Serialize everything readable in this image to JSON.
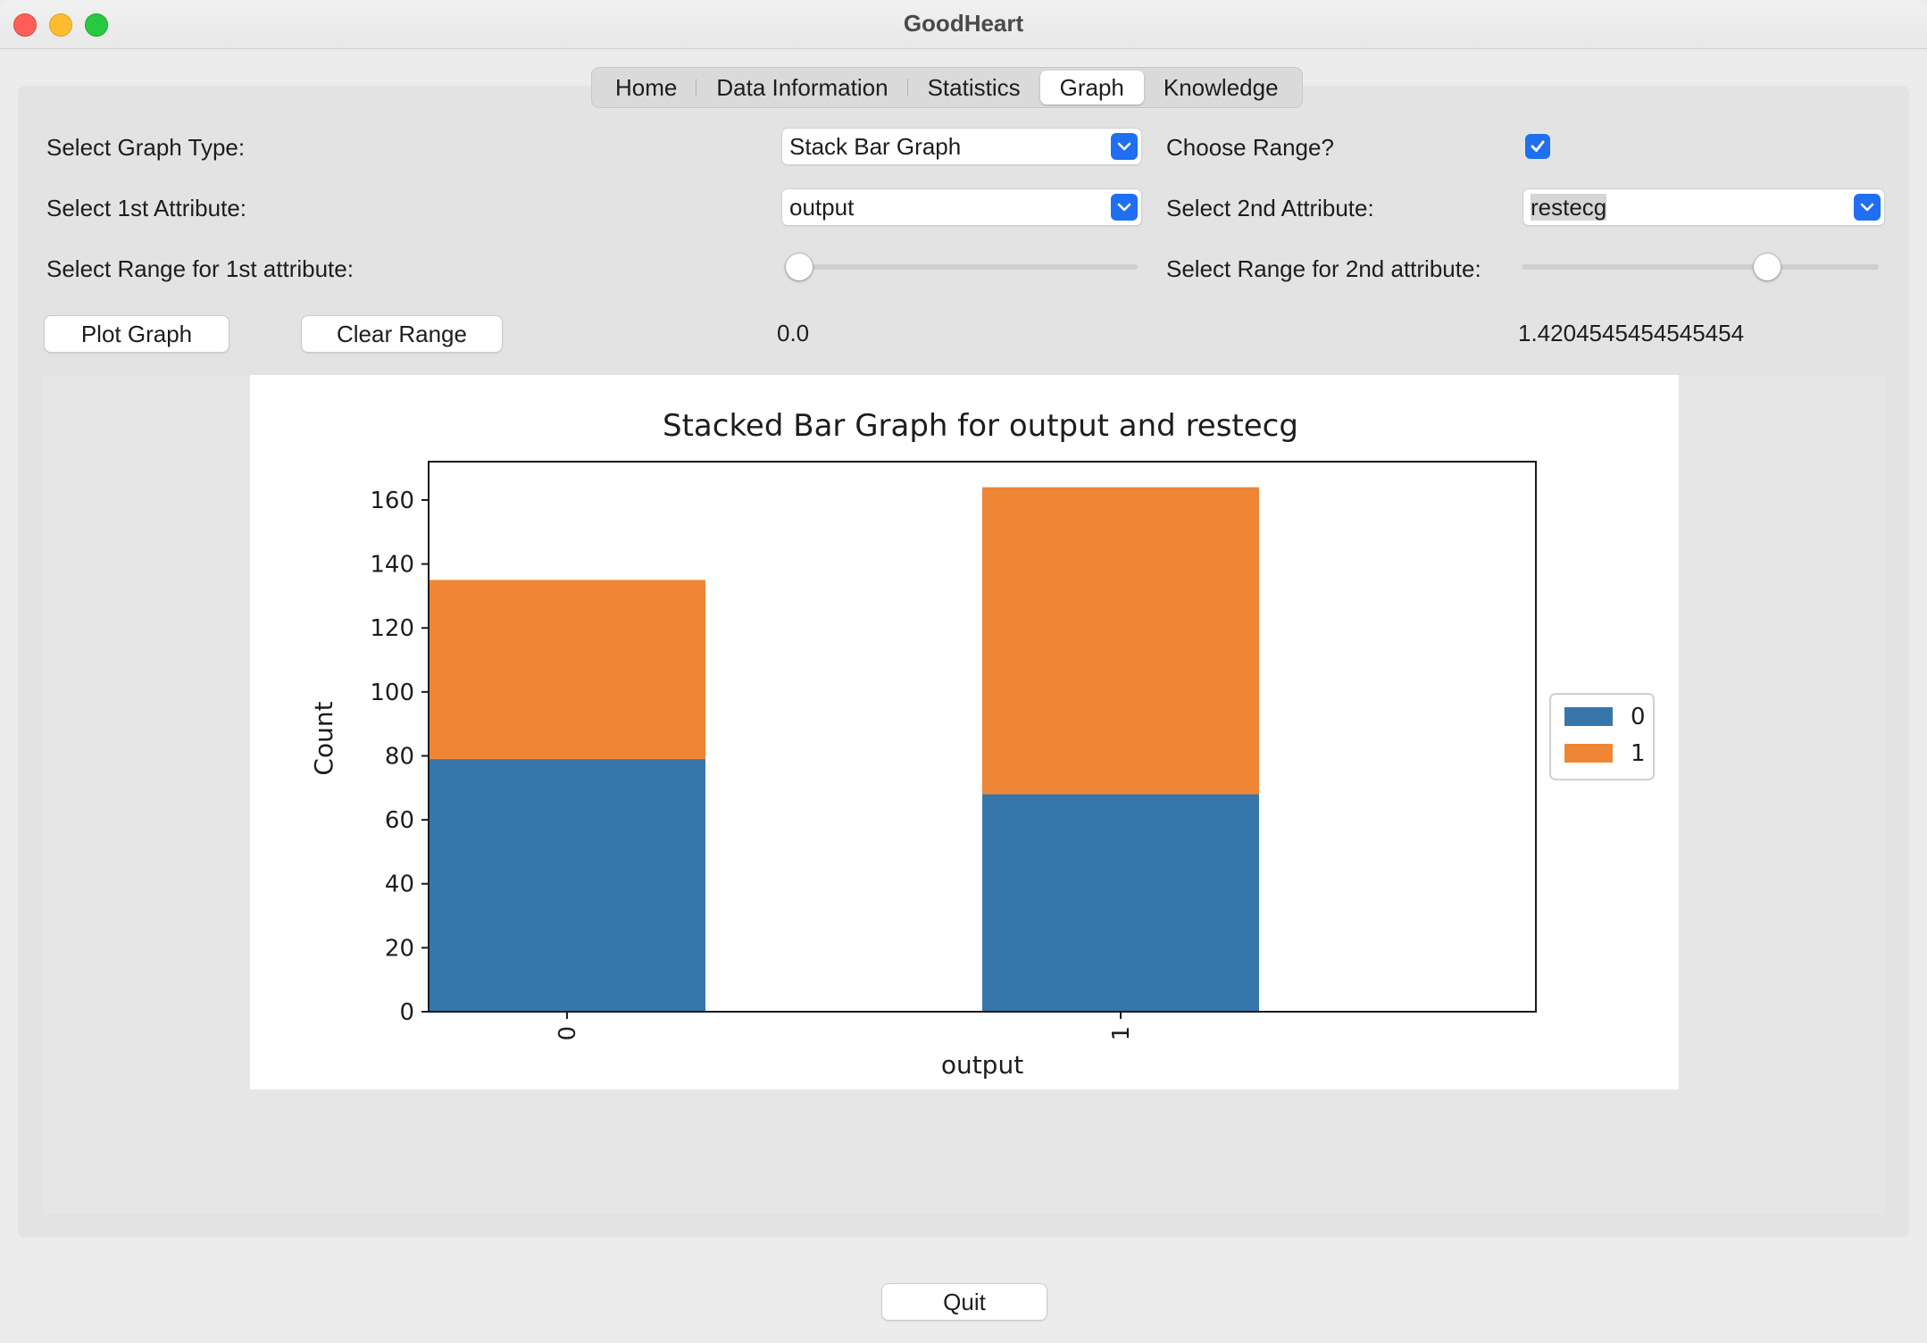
{
  "window": {
    "title": "GoodHeart"
  },
  "tabs": [
    {
      "label": "Home"
    },
    {
      "label": "Data Information"
    },
    {
      "label": "Statistics"
    },
    {
      "label": "Graph"
    },
    {
      "label": "Knowledge"
    }
  ],
  "active_tab": "Graph",
  "controls": {
    "graph_type_label": "Select Graph Type:",
    "graph_type_value": "Stack Bar Graph",
    "choose_range_label": "Choose Range?",
    "choose_range_checked": true,
    "attr1_label": "Select 1st Attribute:",
    "attr1_value": "output",
    "attr2_label": "Select 2nd Attribute:",
    "attr2_value": "restecg",
    "range1_label": "Select Range for 1st attribute:",
    "range2_label": "Select Range for 2nd attribute:",
    "range1_value": "0.0",
    "range2_value": "1.4204545454545454",
    "plot_button": "Plot Graph",
    "clear_button": "Clear Range",
    "quit_button": "Quit"
  },
  "colors": {
    "accent": "#1f6ff0",
    "series0": "#3776ab",
    "series1": "#ef8636"
  },
  "chart_data": {
    "type": "bar",
    "stacked": true,
    "title": "Stacked Bar Graph for output and restecg",
    "xlabel": "output",
    "ylabel": "Count",
    "categories": [
      "0",
      "1"
    ],
    "series": [
      {
        "name": "0",
        "values": [
          79,
          68
        ]
      },
      {
        "name": "1",
        "values": [
          56,
          96
        ]
      }
    ],
    "ylim": [
      0,
      172
    ],
    "yticks": [
      0,
      20,
      40,
      60,
      80,
      100,
      120,
      140,
      160
    ],
    "legend_position": "right"
  }
}
